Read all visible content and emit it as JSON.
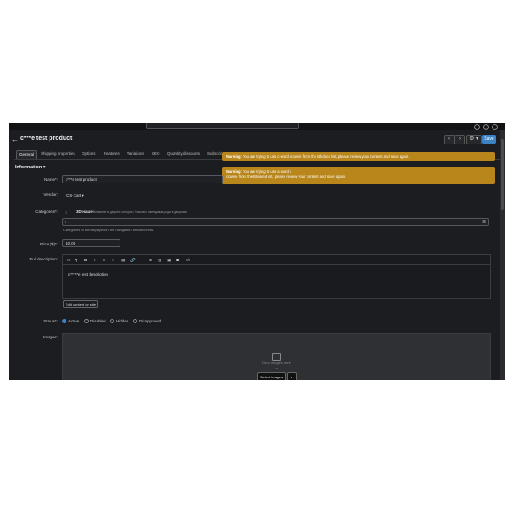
{
  "header": {
    "title": "c***e test product",
    "back_icon": "arrow-left-icon",
    "prev": "‹",
    "next": "›",
    "gear": "⚙ ▾",
    "save_label": "Save"
  },
  "tabs": [
    {
      "label": "General"
    },
    {
      "label": "Shipping properties"
    },
    {
      "label": "Options"
    },
    {
      "label": "Features"
    },
    {
      "label": "Variations"
    },
    {
      "label": "SEO"
    },
    {
      "label": "Quantity discounts"
    },
    {
      "label": "Subscribe"
    }
  ],
  "warnings": [
    {
      "title": "Warning",
      "text": "You are trying to use c-word crowne from the Blocked list, please review your content and save again."
    },
    {
      "title": "Warning",
      "line1": "You are trying to use a word c",
      "line2": "crowne from the Blocked list, please review your content and save again."
    }
  ],
  "section": {
    "title": "Information",
    "caret": "▾"
  },
  "fields": {
    "name": {
      "label": "Name*:",
      "value": "c***e test product"
    },
    "vendor": {
      "label": "Vendor:",
      "value": "CS-Cart ▾"
    },
    "categories": {
      "label": "Categories*:",
      "chip_title": "3D-наше",
      "chip_path": "Вниманье в дворяне сегодня / Спасибо, миледи как ради в Дворянки",
      "hint": "Categories to be displayed in the navigation breadcrumbs."
    },
    "price": {
      "label": "Price ($)*:",
      "value": "10.00"
    },
    "description": {
      "label": "Full description:",
      "text": "c*****e test description",
      "edit_label": "Edit content on site"
    },
    "status": {
      "label": "Status*:",
      "options": [
        "Active",
        "Disabled",
        "Hidden",
        "Disapproved"
      ],
      "selected": "Active"
    },
    "images": {
      "label": "Images:",
      "drop_text": "Drop images here",
      "or_text": "or",
      "select_label": "Select images",
      "arrow": "▾"
    }
  },
  "editor_tools": [
    "<>",
    "¶",
    "B",
    "I",
    "S",
    "≡",
    "▤",
    "🔗",
    "—",
    "⊞",
    "▥",
    "▣",
    "⧉",
    "</>"
  ]
}
